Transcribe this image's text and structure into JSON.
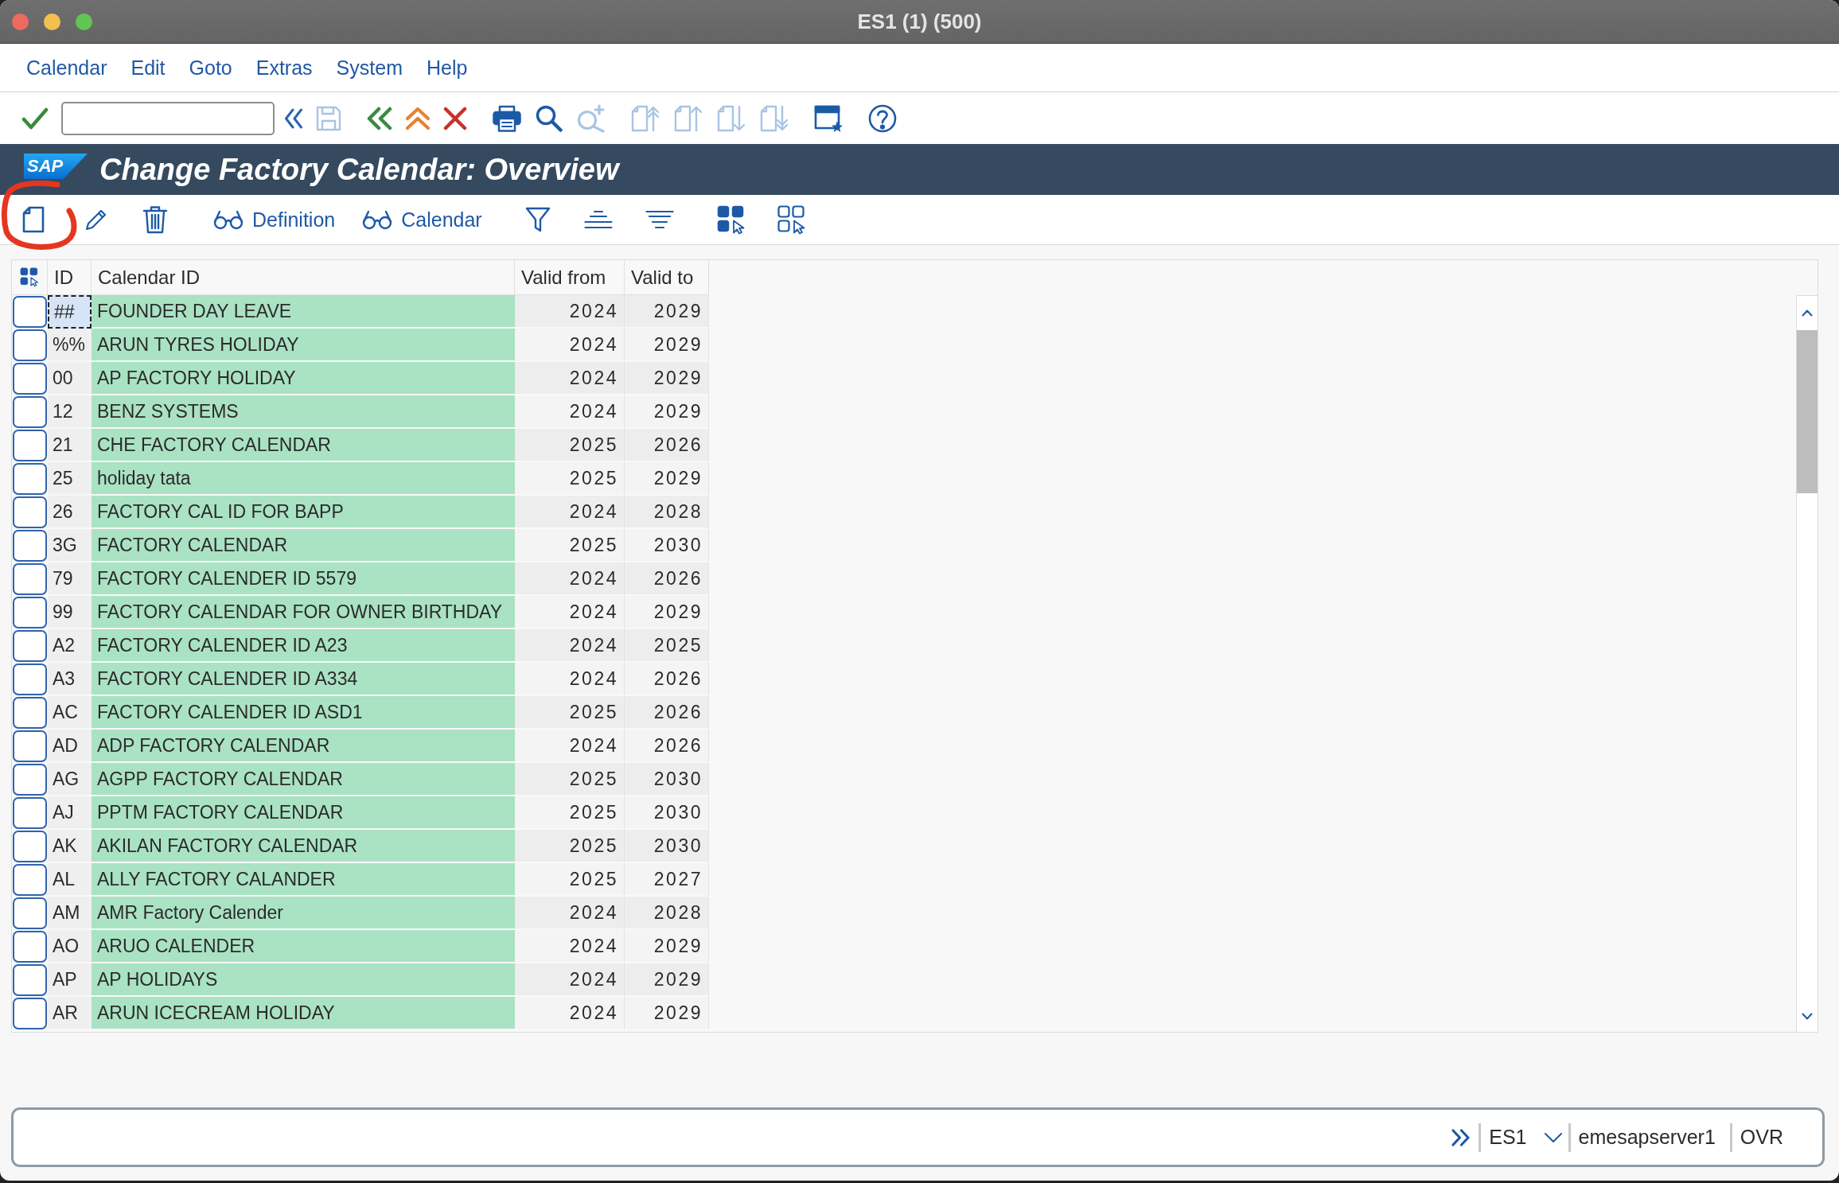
{
  "window": {
    "title": "ES1 (1) (500)"
  },
  "menu_bar": [
    "Calendar",
    "Edit",
    "Goto",
    "Extras",
    "System",
    "Help"
  ],
  "standard_toolbar": [
    {
      "kind": "check",
      "disabled": false
    },
    {
      "kind": "field",
      "disabled": false
    },
    {
      "kind": "expand",
      "disabled": false
    },
    {
      "kind": "floppy",
      "disabled": true
    },
    {
      "kind": "back",
      "disabled": false
    },
    {
      "kind": "up",
      "disabled": false
    },
    {
      "kind": "cancel",
      "disabled": false
    },
    {
      "kind": "printer",
      "disabled": false
    },
    {
      "kind": "magnifier",
      "disabled": false
    },
    {
      "kind": "magnifierplus",
      "disabled": true
    },
    {
      "kind": "firstpage",
      "disabled": true
    },
    {
      "kind": "prevpage",
      "disabled": true
    },
    {
      "kind": "nextpage",
      "disabled": true
    },
    {
      "kind": "lastpage",
      "disabled": true
    },
    {
      "kind": "windowstar",
      "disabled": false
    },
    {
      "kind": "help",
      "disabled": false
    }
  ],
  "header": {
    "logo": "SAP",
    "title": "Change Factory Calendar: Overview"
  },
  "application_toolbar": {
    "buttons": [
      {
        "kind": "page"
      },
      {
        "kind": "pencil"
      },
      {
        "kind": "trash"
      },
      {
        "kind": "glasses",
        "label": "Definition"
      },
      {
        "kind": "glasses",
        "label": "Calendar"
      },
      {
        "kind": "funnel"
      },
      {
        "kind": "bars"
      },
      {
        "kind": "lines"
      },
      {
        "kind": "tiles"
      },
      {
        "kind": "outline"
      }
    ],
    "annotation": {
      "kind": "circle"
    }
  },
  "table": {
    "columns": [
      "ID",
      "Calendar ID",
      "Valid from",
      "Valid to"
    ],
    "rows": [
      {
        "id": "##",
        "calendar_id": "FOUNDER DAY LEAVE",
        "valid_from": "2024",
        "valid_to": "2029",
        "selected": false,
        "focused": true
      },
      {
        "id": "%%",
        "calendar_id": "ARUN TYRES HOLIDAY",
        "valid_from": "2024",
        "valid_to": "2029",
        "selected": false,
        "focused": false
      },
      {
        "id": "00",
        "calendar_id": "AP FACTORY HOLIDAY",
        "valid_from": "2024",
        "valid_to": "2029",
        "selected": false,
        "focused": false
      },
      {
        "id": "12",
        "calendar_id": "BENZ SYSTEMS",
        "valid_from": "2024",
        "valid_to": "2029",
        "selected": false,
        "focused": false
      },
      {
        "id": "21",
        "calendar_id": "CHE FACTORY CALENDAR",
        "valid_from": "2025",
        "valid_to": "2026",
        "selected": false,
        "focused": false
      },
      {
        "id": "25",
        "calendar_id": "holiday tata",
        "valid_from": "2025",
        "valid_to": "2029",
        "selected": false,
        "focused": false
      },
      {
        "id": "26",
        "calendar_id": "FACTORY CAL ID FOR BAPP",
        "valid_from": "2024",
        "valid_to": "2028",
        "selected": false,
        "focused": false
      },
      {
        "id": "3G",
        "calendar_id": "FACTORY CALENDAR",
        "valid_from": "2025",
        "valid_to": "2030",
        "selected": false,
        "focused": false
      },
      {
        "id": "79",
        "calendar_id": "FACTORY CALENDER ID 5579",
        "valid_from": "2024",
        "valid_to": "2026",
        "selected": false,
        "focused": false
      },
      {
        "id": "99",
        "calendar_id": "FACTORY CALENDAR FOR OWNER BIRTHDAY",
        "valid_from": "2024",
        "valid_to": "2029",
        "selected": false,
        "focused": false
      },
      {
        "id": "A2",
        "calendar_id": "FACTORY CALENDER ID A23",
        "valid_from": "2024",
        "valid_to": "2025",
        "selected": false,
        "focused": false
      },
      {
        "id": "A3",
        "calendar_id": "FACTORY CALENDER ID A334",
        "valid_from": "2024",
        "valid_to": "2026",
        "selected": false,
        "focused": false
      },
      {
        "id": "AC",
        "calendar_id": "FACTORY CALENDER ID ASD1",
        "valid_from": "2025",
        "valid_to": "2026",
        "selected": false,
        "focused": false
      },
      {
        "id": "AD",
        "calendar_id": "ADP FACTORY CALENDAR",
        "valid_from": "2024",
        "valid_to": "2026",
        "selected": false,
        "focused": false
      },
      {
        "id": "AG",
        "calendar_id": "AGPP FACTORY CALENDAR",
        "valid_from": "2025",
        "valid_to": "2030",
        "selected": false,
        "focused": false
      },
      {
        "id": "AJ",
        "calendar_id": "PPTM FACTORY CALENDAR",
        "valid_from": "2025",
        "valid_to": "2030",
        "selected": false,
        "focused": false
      },
      {
        "id": "AK",
        "calendar_id": "AKILAN FACTORY CALENDAR",
        "valid_from": "2025",
        "valid_to": "2030",
        "selected": false,
        "focused": false
      },
      {
        "id": "AL",
        "calendar_id": "ALLY FACTORY CALANDER",
        "valid_from": "2025",
        "valid_to": "2027",
        "selected": false,
        "focused": false
      },
      {
        "id": "AM",
        "calendar_id": "AMR Factory Calender",
        "valid_from": "2024",
        "valid_to": "2028",
        "selected": false,
        "focused": false
      },
      {
        "id": "AO",
        "calendar_id": "ARUO CALENDER",
        "valid_from": "2024",
        "valid_to": "2029",
        "selected": false,
        "focused": false
      },
      {
        "id": "AP",
        "calendar_id": "AP HOLIDAYS",
        "valid_from": "2024",
        "valid_to": "2029",
        "selected": false,
        "focused": false
      },
      {
        "id": "AR",
        "calendar_id": "ARUN ICECREAM HOLIDAY",
        "valid_from": "2024",
        "valid_to": "2029",
        "selected": false,
        "focused": false
      }
    ]
  },
  "status_bar": {
    "system": "ES1",
    "server": "emesapserver1",
    "mode": "OVR"
  }
}
